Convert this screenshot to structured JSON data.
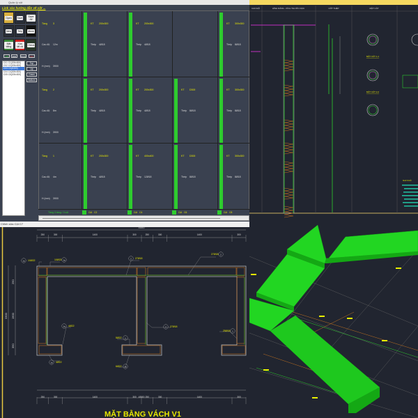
{
  "column_manager": {
    "window_title": "Quản lý cột",
    "link_title": "Link vào hướng dẫn vẽ cột ...",
    "tools": [
      "Open",
      "Save",
      "Save All",
      "New",
      "Tiếp",
      "Move",
      "Mặt bằng",
      "Xóa tất cả",
      "Check"
    ],
    "small_buttons": [
      "Add",
      "Edit",
      "Copy",
      "Del"
    ],
    "list_items": [
      "C01 C1(200x300)",
      "C02 C2(200x300)",
      "C03 C3(D300)",
      "C04 C4(300x300)",
      "C05 C5(200x300)"
    ],
    "selected_index": 2,
    "side_buttons": [
      "Top",
      "Up",
      "Down",
      "Bottom"
    ],
    "labels": {
      "floor": "Tầng",
      "elevation": "Cao độ",
      "height": "H (mm)",
      "size": "KT",
      "steel": "Thép"
    },
    "rows": [
      {
        "floor": "3",
        "elevation": "12m",
        "height": "3900",
        "cells": [
          {
            "size": "200x300",
            "steel": "4Ø18"
          },
          {
            "size": "200x300",
            "steel": "4Ø18"
          },
          null,
          {
            "size": "300x300",
            "steel": "8Ø18"
          }
        ]
      },
      {
        "floor": "2",
        "elevation": "8m",
        "height": "3900",
        "cells": [
          {
            "size": "200x300",
            "steel": "4Ø18"
          },
          {
            "size": "200x300",
            "steel": "4Ø18"
          },
          {
            "size": "D300",
            "steel": "8Ø18"
          },
          {
            "size": "300x300",
            "steel": "8Ø18"
          }
        ]
      },
      {
        "floor": "1",
        "elevation": "4m",
        "height": "3900",
        "cells": [
          {
            "size": "200x300",
            "steel": "4Ø18"
          },
          {
            "size": "400x400",
            "steel": "12Ø18"
          },
          {
            "size": "D300",
            "steel": "8Ø18"
          },
          {
            "size": "300x300",
            "steel": "8Ø18"
          }
        ]
      }
    ],
    "footer_summary": "Tầng 3 tầng / 3 cột",
    "footer_columns": [
      {
        "label": "Cột",
        "name": "C2"
      },
      {
        "label": "Cột",
        "name": "C4"
      },
      {
        "label": "Cột",
        "name": "C6"
      },
      {
        "label": "Cột",
        "name": "C8"
      }
    ],
    "colors": {
      "accent": "#2ecc2e",
      "label": "#e8e800",
      "panel": "#3a4150"
    }
  },
  "wall_plan": {
    "window_title": "Chỉnh sửa Cột C7",
    "total_dim": "4500",
    "segment_dims": [
      "250",
      "300",
      "1400",
      "300",
      "250",
      "300",
      "1400",
      "300",
      "250"
    ],
    "left_dims": [
      "3300",
      "250",
      "1900",
      "350"
    ],
    "rebar_labels": [
      {
        "mark": "1a",
        "text": "10Ø22"
      },
      {
        "mark": "1a",
        "text": "10Ø22"
      },
      {
        "mark": "2",
        "text": "27Ø18"
      },
      {
        "mark": "2",
        "text": "27Ø18"
      },
      {
        "mark": "2",
        "text": "27Ø18"
      },
      {
        "mark": "1",
        "text": "25Ø18"
      },
      {
        "mark": "1a",
        "text": "4Ø22"
      },
      {
        "mark": "1",
        "text": "5Ø22"
      },
      {
        "mark": "1a",
        "text": "4Ø22"
      },
      {
        "mark": "1a",
        "text": "6Ø22"
      }
    ],
    "title": "MẶT BẰNG VÁCH V1"
  },
  "column_detail": {
    "headers": [
      "CAO ĐỘ",
      "HÌNH DÁNG - KÍCH THƯỚC DỌC",
      "CỐT THÉP",
      "MẶT CẮT"
    ],
    "sections": [
      "MẶT CẮT 1-1",
      "MẶT CẮT 2-2"
    ],
    "note_title": "GHI CHÚ"
  },
  "model_3d": {
    "colors": {
      "beam": "#22d622",
      "beam_dark": "#16a816"
    }
  }
}
